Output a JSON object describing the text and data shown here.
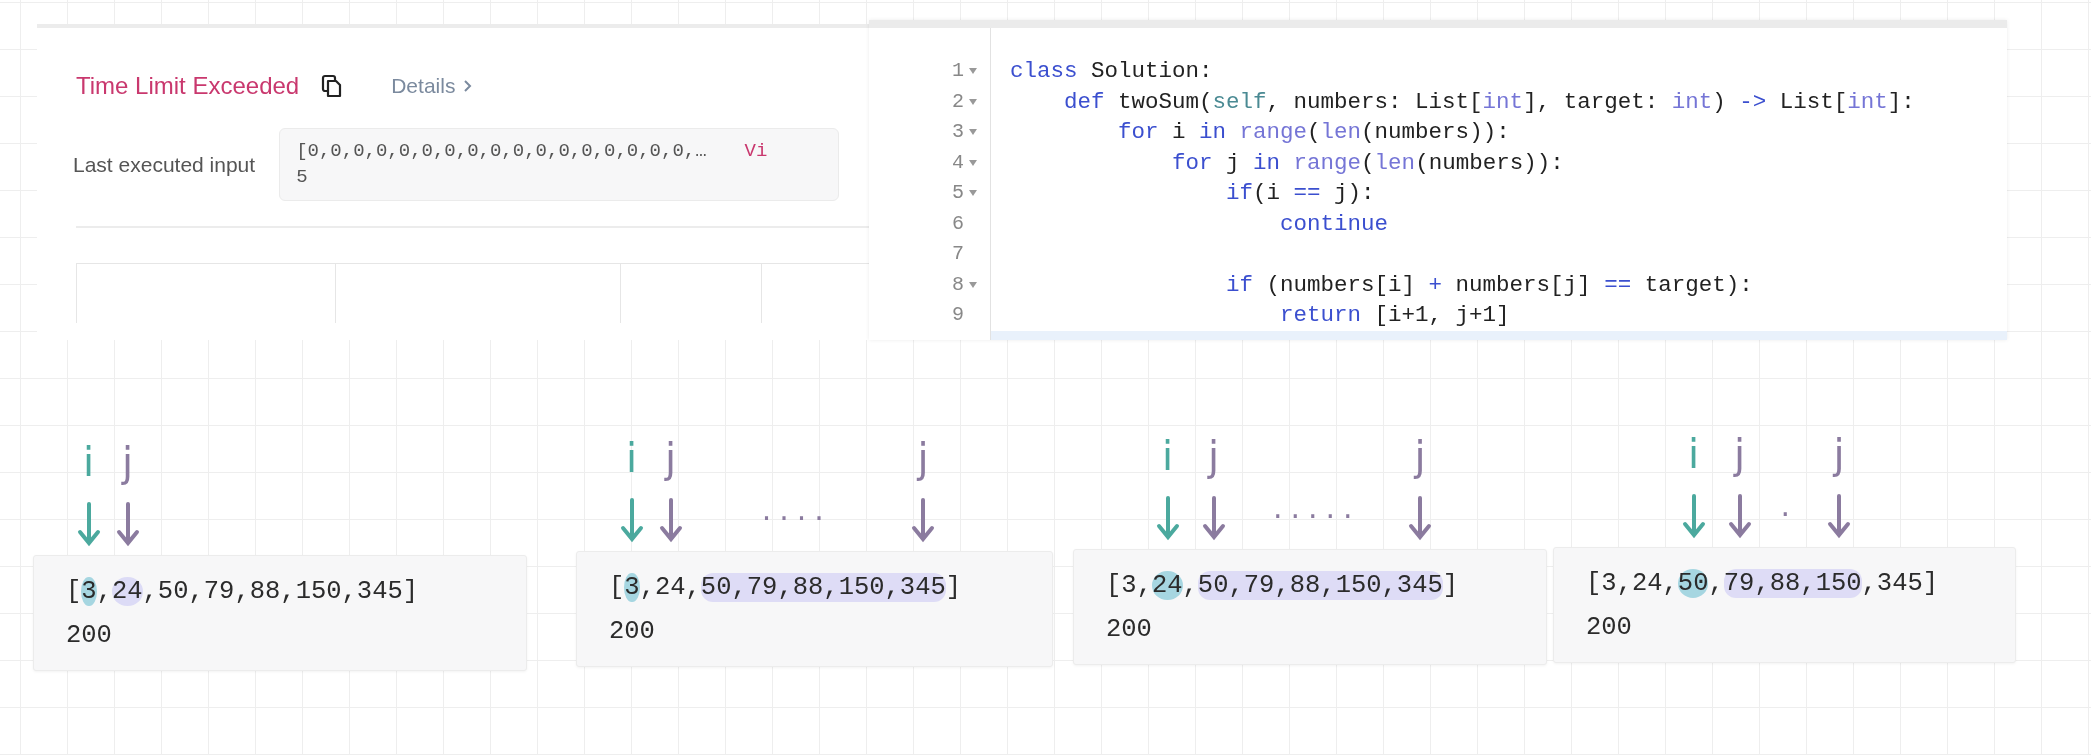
{
  "result_panel": {
    "status": "Time Limit Exceeded",
    "details_link": "Details",
    "input_label": "Last executed input",
    "input_lines": [
      "[0,0,0,0,0,0,0,0,0,0,0,0,0,0,0,0,0,…",
      "5"
    ],
    "view_link": "Vi"
  },
  "code_editor": {
    "lines": [
      {
        "number": "1",
        "foldable": true,
        "tokens": [
          {
            "text": "class",
            "kind": "kw"
          },
          {
            "text": " Solution:",
            "kind": "plain"
          }
        ]
      },
      {
        "number": "2",
        "foldable": true,
        "tokens": [
          {
            "text": "    def",
            "kind": "kw"
          },
          {
            "text": " twoSum(",
            "kind": "plain"
          },
          {
            "text": "self",
            "kind": "self"
          },
          {
            "text": ", numbers: List[",
            "kind": "plain"
          },
          {
            "text": "int",
            "kind": "builtin"
          },
          {
            "text": "], target: ",
            "kind": "plain"
          },
          {
            "text": "int",
            "kind": "builtin"
          },
          {
            "text": ") ",
            "kind": "plain"
          },
          {
            "text": "->",
            "kind": "op"
          },
          {
            "text": " List[",
            "kind": "plain"
          },
          {
            "text": "int",
            "kind": "builtin"
          },
          {
            "text": "]:",
            "kind": "plain"
          }
        ]
      },
      {
        "number": "3",
        "foldable": true,
        "tokens": [
          {
            "text": "        for",
            "kind": "kw"
          },
          {
            "text": " i ",
            "kind": "plain"
          },
          {
            "text": "in ",
            "kind": "kw"
          },
          {
            "text": "range",
            "kind": "builtin"
          },
          {
            "text": "(",
            "kind": "plain"
          },
          {
            "text": "len",
            "kind": "builtin"
          },
          {
            "text": "(numbers)):",
            "kind": "plain"
          }
        ]
      },
      {
        "number": "4",
        "foldable": true,
        "tokens": [
          {
            "text": "            for",
            "kind": "kw"
          },
          {
            "text": " j ",
            "kind": "plain"
          },
          {
            "text": "in ",
            "kind": "kw"
          },
          {
            "text": "range",
            "kind": "builtin"
          },
          {
            "text": "(",
            "kind": "plain"
          },
          {
            "text": "len",
            "kind": "builtin"
          },
          {
            "text": "(numbers)):",
            "kind": "plain"
          }
        ]
      },
      {
        "number": "5",
        "foldable": true,
        "tokens": [
          {
            "text": "                if",
            "kind": "kw"
          },
          {
            "text": "(i ",
            "kind": "plain"
          },
          {
            "text": "==",
            "kind": "op"
          },
          {
            "text": " j):",
            "kind": "plain"
          }
        ]
      },
      {
        "number": "6",
        "foldable": false,
        "tokens": [
          {
            "text": "                    continue",
            "kind": "kw"
          }
        ]
      },
      {
        "number": "7",
        "foldable": false
      },
      {
        "number": "8",
        "foldable": true,
        "tokens": [
          {
            "text": "                if",
            "kind": "kw"
          },
          {
            "text": " (numbers[i] ",
            "kind": "plain"
          },
          {
            "text": "+",
            "kind": "op"
          },
          {
            "text": " numbers[j] ",
            "kind": "plain"
          },
          {
            "text": "==",
            "kind": "op"
          },
          {
            "text": " target):",
            "kind": "plain"
          }
        ]
      },
      {
        "number": "9",
        "foldable": false,
        "tokens": [
          {
            "text": "                    return",
            "kind": "kw"
          },
          {
            "text": " [i+1, j+1]",
            "kind": "plain"
          }
        ]
      }
    ]
  },
  "cards": [
    {
      "open": "[",
      "separator": ",",
      "close": "]",
      "target": "200",
      "items": [
        {
          "value": "3",
          "i_marked": true,
          "j_marked": false,
          "pointer": {
            "label": "i",
            "color": "#4ba99e"
          }
        },
        {
          "value": "24",
          "i_marked": false,
          "j_marked": true,
          "pointer": {
            "label": "j",
            "color": "#8b7b9f"
          }
        },
        {
          "value": "50",
          "i_marked": false,
          "j_marked": false
        },
        {
          "value": "79",
          "i_marked": false,
          "j_marked": false
        },
        {
          "value": "88",
          "i_marked": false,
          "j_marked": false
        },
        {
          "value": "150",
          "i_marked": false,
          "j_marked": false
        },
        {
          "value": "345",
          "i_marked": false,
          "j_marked": false
        }
      ]
    },
    {
      "open": "[",
      "separator": ",",
      "close": "]",
      "target": "200",
      "ellipsis": "....",
      "items": [
        {
          "value": "3",
          "i_marked": true,
          "j_marked": false,
          "pointer": {
            "label": "i",
            "color": "#4ba99e"
          }
        },
        {
          "value": "24",
          "i_marked": false,
          "j_marked": false,
          "pointer": {
            "label": "j",
            "color": "#8b7b9f"
          }
        },
        {
          "value": "50",
          "i_marked": false,
          "j_marked": true
        },
        {
          "value": "79",
          "i_marked": false,
          "j_marked": true
        },
        {
          "value": "88",
          "i_marked": false,
          "j_marked": true
        },
        {
          "value": "150",
          "i_marked": false,
          "j_marked": true
        },
        {
          "value": "345",
          "i_marked": false,
          "j_marked": true,
          "pointer": {
            "label": "j",
            "color": "#8b7b9f"
          }
        }
      ]
    },
    {
      "open": "[",
      "separator": ",",
      "close": "]",
      "target": "200",
      "ellipsis": ".....",
      "items": [
        {
          "value": "3",
          "i_marked": false,
          "j_marked": false
        },
        {
          "value": "24",
          "i_marked": true,
          "j_marked": false,
          "pointer": {
            "label": "i",
            "color": "#4ba99e"
          }
        },
        {
          "value": "50",
          "i_marked": false,
          "j_marked": true,
          "pointer": {
            "label": "j",
            "color": "#8b7b9f"
          }
        },
        {
          "value": "79",
          "i_marked": false,
          "j_marked": true
        },
        {
          "value": "88",
          "i_marked": false,
          "j_marked": true
        },
        {
          "value": "150",
          "i_marked": false,
          "j_marked": true
        },
        {
          "value": "345",
          "i_marked": false,
          "j_marked": true,
          "pointer": {
            "label": "j",
            "color": "#8b7b9f"
          }
        }
      ]
    },
    {
      "open": "[",
      "separator": ",",
      "close": "]",
      "target": "200",
      "ellipsis": ".",
      "items": [
        {
          "value": "3",
          "i_marked": false,
          "j_marked": false
        },
        {
          "value": "24",
          "i_marked": false,
          "j_marked": false
        },
        {
          "value": "50",
          "i_marked": true,
          "j_marked": false,
          "pointer": {
            "label": "i",
            "color": "#4ba99e"
          }
        },
        {
          "value": "79",
          "i_marked": false,
          "j_marked": true,
          "pointer": {
            "label": "j",
            "color": "#8b7b9f"
          }
        },
        {
          "value": "88",
          "i_marked": false,
          "j_marked": true
        },
        {
          "value": "150",
          "i_marked": false,
          "j_marked": true,
          "pointer": {
            "label": "j",
            "color": "#8b7b9f"
          }
        },
        {
          "value": "345",
          "i_marked": false,
          "j_marked": false
        }
      ]
    }
  ]
}
